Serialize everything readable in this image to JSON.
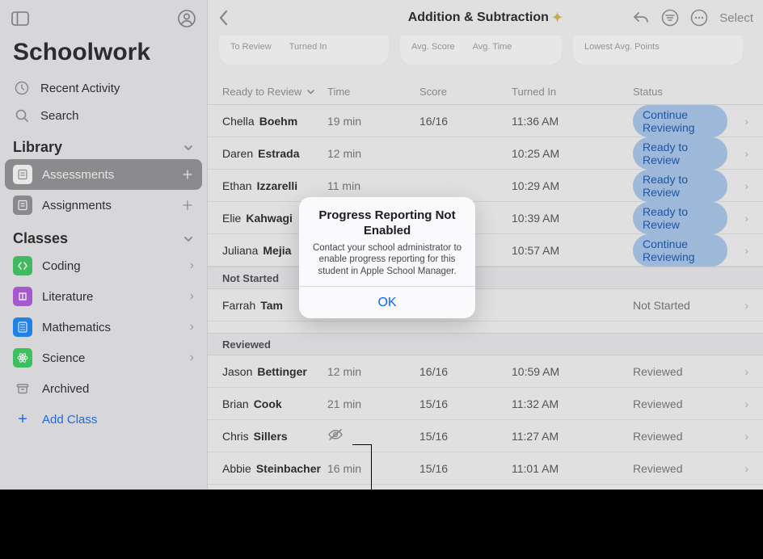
{
  "sidebar": {
    "app_title": "Schoolwork",
    "recent_label": "Recent Activity",
    "search_label": "Search",
    "library_header": "Library",
    "library_items": [
      {
        "label": "Assessments",
        "selected": true,
        "plus": true,
        "icon_bg": "#8f8f93"
      },
      {
        "label": "Assignments",
        "selected": false,
        "plus": true,
        "icon_bg": "#8e8e92"
      }
    ],
    "classes_header": "Classes",
    "class_items": [
      {
        "label": "Coding",
        "icon_bg": "#34c759"
      },
      {
        "label": "Literature",
        "icon_bg": "#af52de"
      },
      {
        "label": "Mathematics",
        "icon_bg": "#0a84ff"
      },
      {
        "label": "Science",
        "icon_bg": "#30d158"
      },
      {
        "label": "Archived",
        "icon_bg": "#transparent"
      }
    ],
    "add_class_label": "Add Class"
  },
  "main": {
    "back_label": "Back",
    "title": "Addition & Subtraction",
    "select_label": "Select",
    "summary_cards": {
      "to_review": "To Review",
      "turned_in": "Turned In",
      "avg_score": "Avg. Score",
      "avg_time": "Avg. Time",
      "lowest": "Lowest Avg. Points"
    },
    "columns": {
      "ready": "Ready to Review",
      "time": "Time",
      "score": "Score",
      "turned_in": "Turned In",
      "status": "Status"
    },
    "rows_ready": [
      {
        "first": "Chella",
        "last": "Boehm",
        "time": "19 min",
        "score": "16/16",
        "turned": "11:36 AM",
        "status": "Continue Reviewing",
        "pill": true
      },
      {
        "first": "Daren",
        "last": "Estrada",
        "time": "12 min",
        "score": "",
        "turned": "10:25 AM",
        "status": "Ready to Review",
        "pill": true
      },
      {
        "first": "Ethan",
        "last": "Izzarelli",
        "time": "11 min",
        "score": "",
        "turned": "10:29 AM",
        "status": "Ready to Review",
        "pill": true
      },
      {
        "first": "Elie",
        "last": "Kahwagi",
        "time": "",
        "score": "",
        "turned": "10:39 AM",
        "status": "Ready to Review",
        "pill": true
      },
      {
        "first": "Juliana",
        "last": "Mejia",
        "time": "",
        "score": "",
        "turned": "10:57 AM",
        "status": "Continue Reviewing",
        "pill": true
      }
    ],
    "section_not_started": "Not Started",
    "rows_not_started": [
      {
        "first": "Farrah",
        "last": "Tam",
        "time": "",
        "score": "",
        "turned": "",
        "status": "Not Started",
        "pill": false
      }
    ],
    "section_reviewed": "Reviewed",
    "rows_reviewed": [
      {
        "first": "Jason",
        "last": "Bettinger",
        "time": "12 min",
        "score": "16/16",
        "turned": "10:59 AM",
        "status": "Reviewed",
        "pill": false
      },
      {
        "first": "Brian",
        "last": "Cook",
        "time": "21 min",
        "score": "15/16",
        "turned": "11:32 AM",
        "status": "Reviewed",
        "pill": false
      },
      {
        "first": "Chris",
        "last": "Sillers",
        "time": "",
        "score": "15/16",
        "turned": "11:27 AM",
        "status": "Reviewed",
        "pill": false,
        "hidden_icon": true
      },
      {
        "first": "Abbie",
        "last": "Steinbacher",
        "time": "16 min",
        "score": "15/16",
        "turned": "11:01 AM",
        "status": "Reviewed",
        "pill": false
      }
    ]
  },
  "dialog": {
    "title": "Progress Reporting Not Enabled",
    "message": "Contact your school administrator to enable progress reporting for this student in Apple School Manager.",
    "ok": "OK"
  }
}
